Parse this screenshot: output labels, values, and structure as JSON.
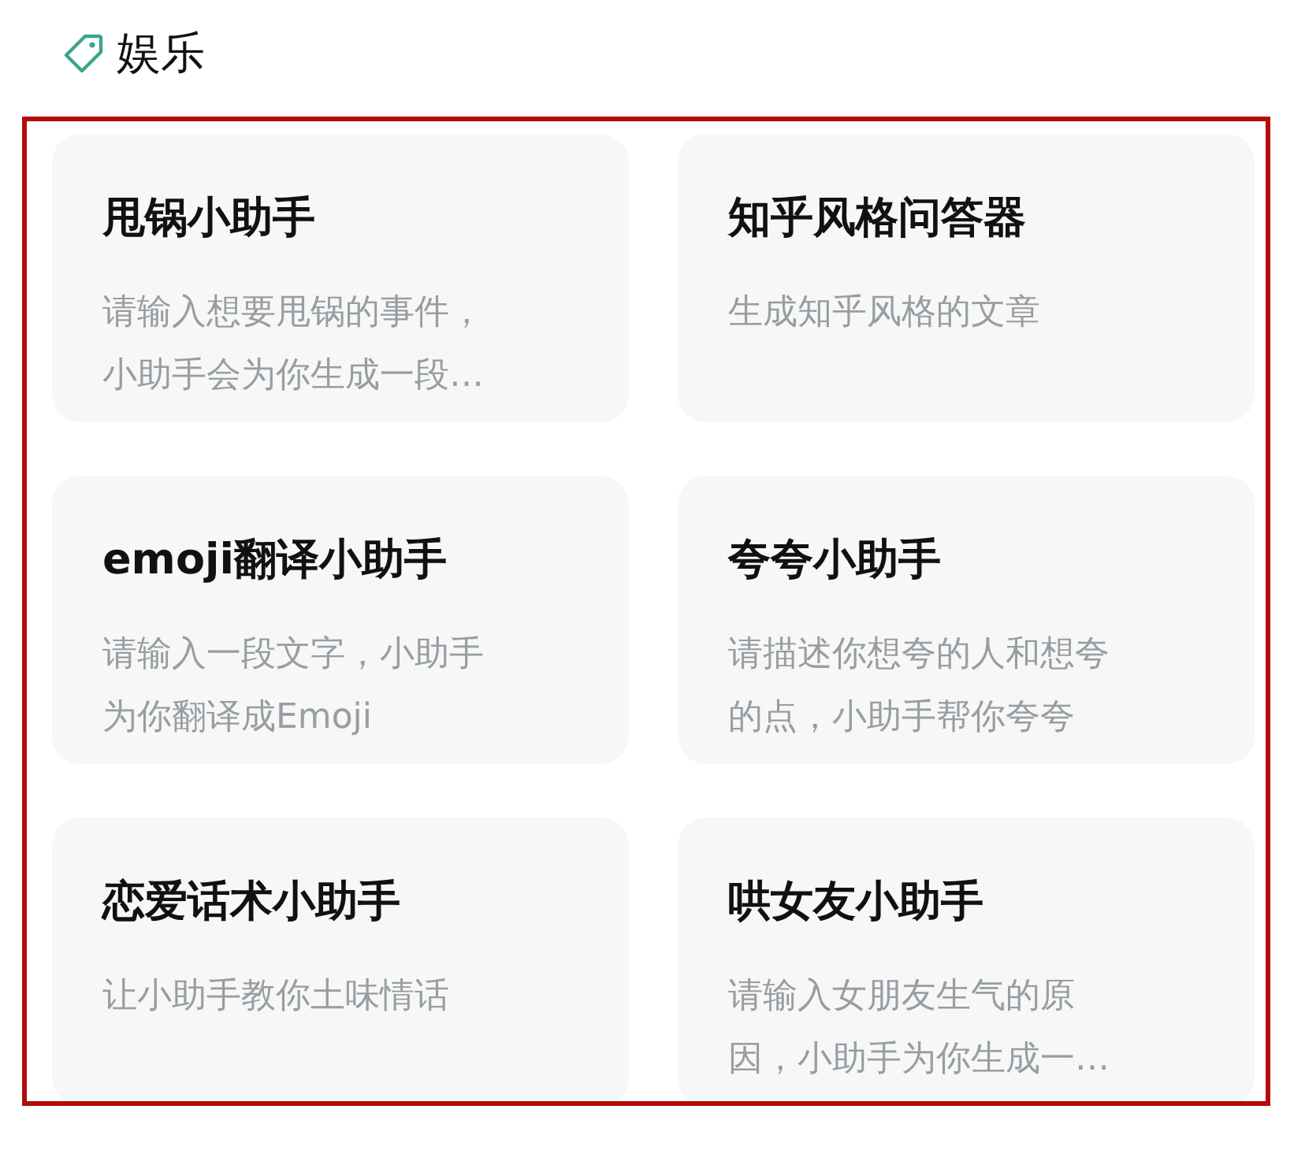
{
  "section": {
    "title": "娱乐"
  },
  "cards": [
    {
      "title": "甩锅小助手",
      "description": "请输入想要甩锅的事件，小助手会为你生成一段…"
    },
    {
      "title": "知乎风格问答器",
      "description": "生成知乎风格的文章"
    },
    {
      "title": "emoji翻译小助手",
      "description": "请输入一段文字，小助手为你翻译成Emoji"
    },
    {
      "title": "夸夸小助手",
      "description": "请描述你想夸的人和想夸的点，小助手帮你夸夸"
    },
    {
      "title": "恋爱话术小助手",
      "description": "让小助手教你土味情话"
    },
    {
      "title": "哄女友小助手",
      "description": "请输入女朋友生气的原因，小助手为你生成一…"
    }
  ]
}
